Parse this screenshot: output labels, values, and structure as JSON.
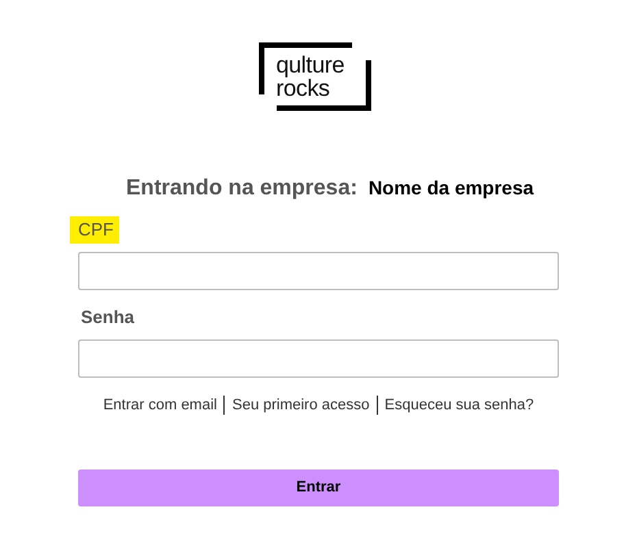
{
  "logo": {
    "line_1": "qulture",
    "line_2": "rocks"
  },
  "heading": {
    "label": "Entrando na empresa:",
    "company": "Nome da empresa"
  },
  "fields": [
    {
      "label": "CPF",
      "highlighted": true
    },
    {
      "label": "Senha",
      "highlighted": false
    }
  ],
  "links": [
    "Entrar com email",
    "Seu primeiro acesso",
    "Esqueceu sua senha?"
  ],
  "submit_button": "Entrar"
}
